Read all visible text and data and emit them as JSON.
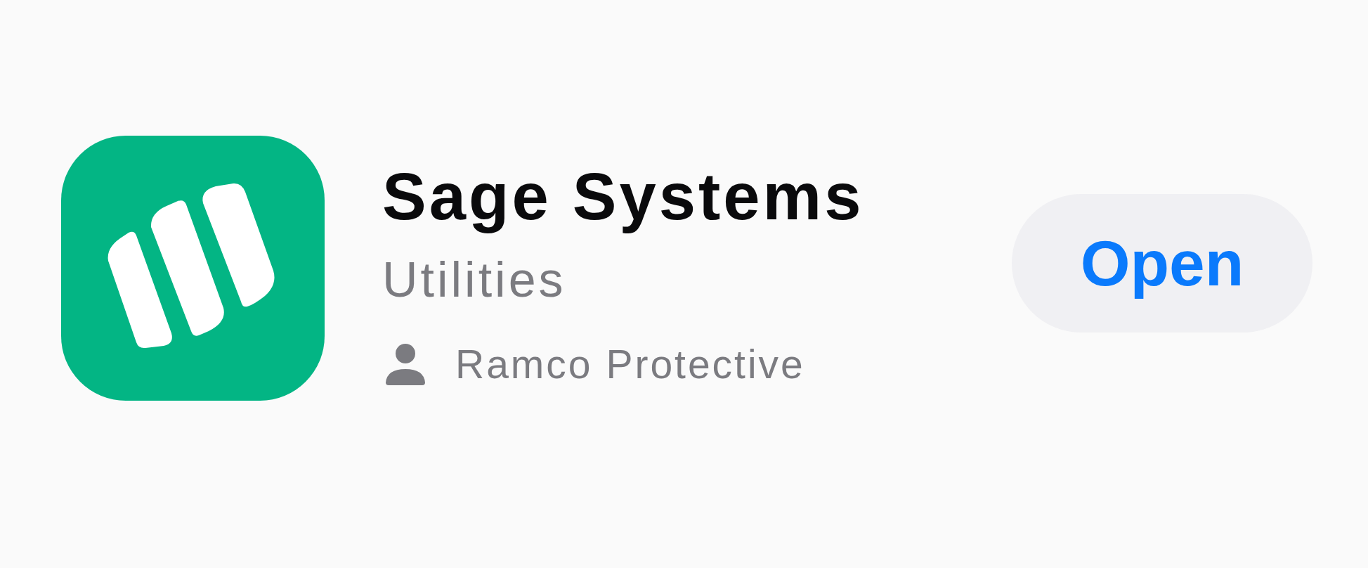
{
  "app": {
    "name": "Sage Systems",
    "category": "Utilities",
    "developer": "Ramco Protective"
  },
  "action_button": {
    "label": "Open"
  }
}
